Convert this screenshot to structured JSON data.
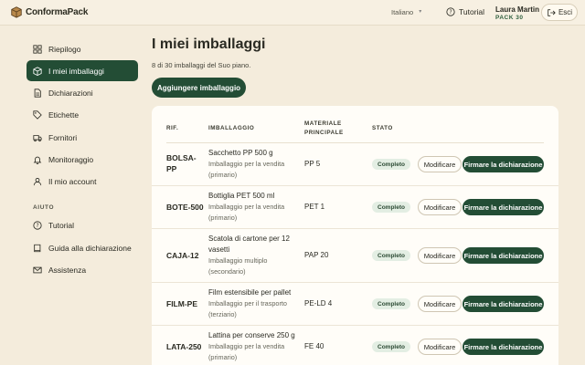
{
  "app": {
    "name": "ConformaPack"
  },
  "topbar": {
    "language": "Italiano",
    "tutorial_label": "Tutorial",
    "user_name": "Laura Martin",
    "user_plan": "PACK 30",
    "logout_label": "Esci"
  },
  "sidebar": {
    "items": [
      {
        "label": "Riepilogo",
        "icon": "grid-icon"
      },
      {
        "label": "I miei imballaggi",
        "icon": "box-icon",
        "active": true
      },
      {
        "label": "Dichiarazioni",
        "icon": "document-icon"
      },
      {
        "label": "Etichette",
        "icon": "tag-icon"
      },
      {
        "label": "Fornitori",
        "icon": "truck-icon"
      },
      {
        "label": "Monitoraggio",
        "icon": "bell-icon"
      },
      {
        "label": "Il mio account",
        "icon": "user-icon"
      }
    ],
    "help_section": "AIUTO",
    "help_items": [
      {
        "label": "Tutorial",
        "icon": "help-circle-icon"
      },
      {
        "label": "Guida alla dichiarazione",
        "icon": "book-icon"
      },
      {
        "label": "Assistenza",
        "icon": "mail-icon"
      }
    ]
  },
  "main": {
    "title": "I miei imballaggi",
    "subtitle": "8 di 30 imballaggi del Suo piano.",
    "add_button": "Aggiungere imballaggio",
    "table": {
      "headers": {
        "ref": "RIF.",
        "packaging": "IMBALLAGGIO",
        "material_1": "MATERIALE",
        "material_2": "PRINCIPALE",
        "status": "STATO"
      },
      "rows": [
        {
          "ref": "BOLSA-PP",
          "name": "Sacchetto PP 500 g",
          "type": "Imballaggio per la vendita (primario)",
          "material": "PP 5",
          "status": "Completo",
          "edit": "Modificare",
          "sign": "Firmare la dichiarazione"
        },
        {
          "ref": "BOTE-500",
          "name": "Bottiglia PET 500 ml",
          "type": "Imballaggio per la vendita (primario)",
          "material": "PET 1",
          "status": "Completo",
          "edit": "Modificare",
          "sign": "Firmare la dichiarazione"
        },
        {
          "ref": "CAJA-12",
          "name": "Scatola di cartone per 12 vasetti",
          "type": "Imballaggio multiplo (secondario)",
          "material": "PAP 20",
          "status": "Completo",
          "edit": "Modificare",
          "sign": "Firmare la dichiarazione"
        },
        {
          "ref": "FILM-PE",
          "name": "Film estensibile per pallet",
          "type": "Imballaggio per il trasporto (terziario)",
          "material": "PE-LD 4",
          "status": "Completo",
          "edit": "Modificare",
          "sign": "Firmare la dichiarazione"
        },
        {
          "ref": "LATA-250",
          "name": "Lattina per conserve 250 g",
          "type": "Imballaggio per la vendita (primario)",
          "material": "FE 40",
          "status": "Completo",
          "edit": "Modificare",
          "sign": "Firmare la dichiarazione"
        }
      ]
    }
  },
  "colors": {
    "accent": "#234d35",
    "background": "#f4ecdc",
    "card": "#fffdf8",
    "badge_bg": "#e3eee3"
  }
}
